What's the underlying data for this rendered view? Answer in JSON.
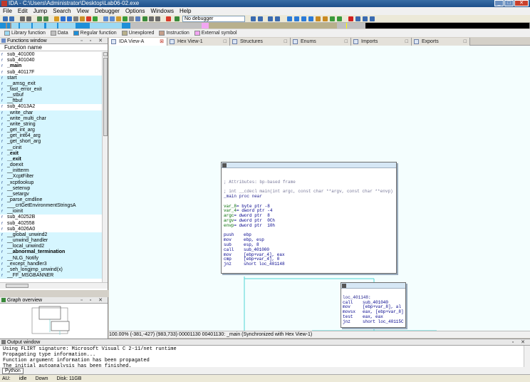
{
  "window": {
    "title": "IDA - C:\\Users\\Administrator\\Desktop\\Lab06-02.exe"
  },
  "menu": [
    "File",
    "Edit",
    "Jump",
    "Search",
    "View",
    "Debugger",
    "Options",
    "Windows",
    "Help"
  ],
  "toolbar": {
    "debugger_select": "No debugger"
  },
  "legend": [
    {
      "label": "Library function",
      "color": "#9dd9f2"
    },
    {
      "label": "Data",
      "color": "#c0c0c0"
    },
    {
      "label": "Regular function",
      "color": "#1e8fd8"
    },
    {
      "label": "Unexplored",
      "color": "#b8b08c"
    },
    {
      "label": "Instruction",
      "color": "#c49e8a"
    },
    {
      "label": "External symbol",
      "color": "#f2a6f2"
    }
  ],
  "functions_window": {
    "title": "Functions window",
    "column": "Function name",
    "items": [
      {
        "name": "sub_401000",
        "lib": false,
        "bold": false
      },
      {
        "name": "sub_401040",
        "lib": false,
        "bold": false
      },
      {
        "name": "_main",
        "lib": false,
        "bold": true
      },
      {
        "name": "sub_40117F",
        "lib": false,
        "bold": false
      },
      {
        "name": "start",
        "lib": true,
        "bold": false
      },
      {
        "name": "__amsg_exit",
        "lib": true,
        "bold": false
      },
      {
        "name": "_fast_error_exit",
        "lib": true,
        "bold": false
      },
      {
        "name": "__stbuf",
        "lib": true,
        "bold": false
      },
      {
        "name": "__ftbuf",
        "lib": true,
        "bold": false
      },
      {
        "name": "sub_4013A2",
        "lib": false,
        "bold": false
      },
      {
        "name": "_write_char",
        "lib": true,
        "bold": false
      },
      {
        "name": "_write_multi_char",
        "lib": true,
        "bold": false
      },
      {
        "name": "_write_string",
        "lib": true,
        "bold": false
      },
      {
        "name": "_get_int_arg",
        "lib": true,
        "bold": false
      },
      {
        "name": "_get_int64_arg",
        "lib": true,
        "bold": false
      },
      {
        "name": "_get_short_arg",
        "lib": true,
        "bold": false
      },
      {
        "name": "__cinit",
        "lib": true,
        "bold": false
      },
      {
        "name": "_exit",
        "lib": true,
        "bold": true
      },
      {
        "name": "__exit",
        "lib": true,
        "bold": true
      },
      {
        "name": "_doexit",
        "lib": true,
        "bold": false
      },
      {
        "name": "__initterm",
        "lib": true,
        "bold": false
      },
      {
        "name": "__XcptFilter",
        "lib": true,
        "bold": false
      },
      {
        "name": "_xcptlookup",
        "lib": true,
        "bold": false
      },
      {
        "name": "__setenvp",
        "lib": true,
        "bold": false
      },
      {
        "name": "__setargv",
        "lib": true,
        "bold": false
      },
      {
        "name": "_parse_cmdline",
        "lib": true,
        "bold": false
      },
      {
        "name": "___crtGetEnvironmentStringsA",
        "lib": true,
        "bold": false
      },
      {
        "name": "__ioinit",
        "lib": true,
        "bold": false
      },
      {
        "name": "sub_40252B",
        "lib": false,
        "bold": false
      },
      {
        "name": "sub_402558",
        "lib": false,
        "bold": false
      },
      {
        "name": "sub_4026A0",
        "lib": false,
        "bold": false
      },
      {
        "name": "__global_unwind2",
        "lib": true,
        "bold": false
      },
      {
        "name": "__unwind_handler",
        "lib": true,
        "bold": false
      },
      {
        "name": "__local_unwind2",
        "lib": true,
        "bold": false
      },
      {
        "name": "__abnormal_termination",
        "lib": true,
        "bold": true
      },
      {
        "name": "__NLG_Notify",
        "lib": true,
        "bold": false
      },
      {
        "name": "_except_handler3",
        "lib": true,
        "bold": false
      },
      {
        "name": "_seh_longjmp_unwind(x)",
        "lib": true,
        "bold": false
      },
      {
        "name": "__FF_MSGBANNER",
        "lib": true,
        "bold": false
      }
    ]
  },
  "graph_overview": {
    "title": "Graph overview"
  },
  "tabs": [
    {
      "label": "IDA View-A",
      "active": true
    },
    {
      "label": "Hex View-1",
      "active": false
    },
    {
      "label": "Structures",
      "active": false
    },
    {
      "label": "Enums",
      "active": false
    },
    {
      "label": "Imports",
      "active": false
    },
    {
      "label": "Exports",
      "active": false
    }
  ],
  "main_node": {
    "attributes": "; Attributes: bp-based frame",
    "signature": "; int __cdecl main(int argc, const char **argv, const char **envp)",
    "proc": "_main proc near",
    "vars": [
      {
        "name": "var_8",
        "rest": "= byte ptr -8"
      },
      {
        "name": "var_4",
        "rest": "= dword ptr -4"
      },
      {
        "name": "argc",
        "rest": "= dword ptr  8"
      },
      {
        "name": "argv",
        "rest": "= dword ptr  0Ch"
      },
      {
        "name": "envp",
        "rest": "= dword ptr  10h"
      }
    ],
    "code": [
      {
        "mn": "push",
        "op": "ebp"
      },
      {
        "mn": "mov",
        "op": "ebp, esp"
      },
      {
        "mn": "sub",
        "op": "esp, 8"
      },
      {
        "mn": "call",
        "op": "sub_401000"
      },
      {
        "mn": "mov",
        "op": "[ebp+var_4], eax"
      },
      {
        "mn": "cmp",
        "op": "[ebp+var_4], 0"
      },
      {
        "mn": "jnz",
        "op": "short loc_401148"
      }
    ]
  },
  "loc_node": {
    "label": "loc_401148:",
    "code": [
      {
        "mn": "call",
        "op": "sub_401040"
      },
      {
        "mn": "mov",
        "op": "[ebp+var_8], al"
      },
      {
        "mn": "movsx",
        "op": "eax, [ebp+var_8]"
      },
      {
        "mn": "test",
        "op": "eax, eax"
      },
      {
        "mn": "jnz",
        "op": "short loc_40115C"
      }
    ]
  },
  "graph_status": "100.00% (-381,-427) (983,733) 00001130 00401130: _main (Synchronized with Hex View-1)",
  "output_window": {
    "title": "Output window",
    "lines": [
      "Using FLIRT signature: Microsoft Visual C 2-11/net runtime",
      "Propagating type information...",
      "Function argument information has been propagated",
      "The initial autoanalysis has been finished."
    ]
  },
  "python_button": "Python",
  "status": {
    "mode": "AU:",
    "state": "idle",
    "direction": "Down",
    "disk": "Disk: 11GB"
  }
}
